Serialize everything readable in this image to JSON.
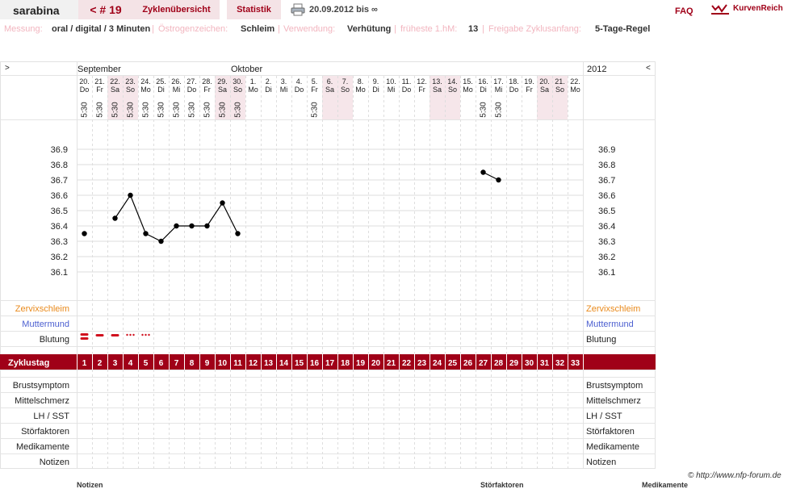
{
  "header": {
    "user": "sarabina",
    "cycle_label": "< # 19",
    "tabs": [
      "Zyklenübersicht",
      "Statistik"
    ],
    "date_range": "20.09.2012 bis ∞",
    "faq": "FAQ",
    "brand": "KurvenReich"
  },
  "settings": [
    {
      "label": "Messung:",
      "value": "oral / digital / 3 Minuten"
    },
    {
      "label": "Östrogenzeichen:",
      "value": "Schleim"
    },
    {
      "label": "Verwendung:",
      "value": "Verhütung"
    },
    {
      "label": "früheste 1.hM:",
      "value": "13"
    },
    {
      "label": "Freigabe Zyklusanfang:",
      "value": "5-Tage-Regel"
    }
  ],
  "colors": {
    "accent": "#a00018",
    "weekend": "#f6e6ea",
    "cervix_label": "#e98a1c",
    "mouth_label": "#4c5fd0",
    "grid": "#dcdcdc"
  },
  "chart_data": {
    "type": "line",
    "nav_left": ">",
    "nav_right": "<",
    "year": "2012",
    "months": [
      {
        "name": "September",
        "start_day": 1
      },
      {
        "name": "Oktober",
        "start_day": 11
      }
    ],
    "days": [
      {
        "date": "20.",
        "wd": "Do",
        "time": "5:30",
        "weekend": false
      },
      {
        "date": "21.",
        "wd": "Fr",
        "time": "5:30",
        "weekend": false
      },
      {
        "date": "22.",
        "wd": "Sa",
        "time": "5:30",
        "weekend": true
      },
      {
        "date": "23.",
        "wd": "So",
        "time": "5:30",
        "weekend": true
      },
      {
        "date": "24.",
        "wd": "Mo",
        "time": "5:30",
        "weekend": false
      },
      {
        "date": "25.",
        "wd": "Di",
        "time": "5:30",
        "weekend": false
      },
      {
        "date": "26.",
        "wd": "Mi",
        "time": "5:30",
        "weekend": false
      },
      {
        "date": "27.",
        "wd": "Do",
        "time": "5:30",
        "weekend": false
      },
      {
        "date": "28.",
        "wd": "Fr",
        "time": "5:30",
        "weekend": false
      },
      {
        "date": "29.",
        "wd": "Sa",
        "time": "5:30",
        "weekend": true
      },
      {
        "date": "30.",
        "wd": "So",
        "time": "5:30",
        "weekend": true
      },
      {
        "date": "1.",
        "wd": "Mo",
        "time": "",
        "weekend": false
      },
      {
        "date": "2.",
        "wd": "Di",
        "time": "",
        "weekend": false
      },
      {
        "date": "3.",
        "wd": "Mi",
        "time": "",
        "weekend": false
      },
      {
        "date": "4.",
        "wd": "Do",
        "time": "",
        "weekend": false
      },
      {
        "date": "5.",
        "wd": "Fr",
        "time": "5:30",
        "weekend": false
      },
      {
        "date": "6.",
        "wd": "Sa",
        "time": "",
        "weekend": true
      },
      {
        "date": "7.",
        "wd": "So",
        "time": "",
        "weekend": true
      },
      {
        "date": "8.",
        "wd": "Mo",
        "time": "",
        "weekend": false
      },
      {
        "date": "9.",
        "wd": "Di",
        "time": "",
        "weekend": false
      },
      {
        "date": "10.",
        "wd": "Mi",
        "time": "",
        "weekend": false
      },
      {
        "date": "11.",
        "wd": "Do",
        "time": "",
        "weekend": false
      },
      {
        "date": "12.",
        "wd": "Fr",
        "time": "",
        "weekend": false
      },
      {
        "date": "13.",
        "wd": "Sa",
        "time": "",
        "weekend": true
      },
      {
        "date": "14.",
        "wd": "So",
        "time": "",
        "weekend": true
      },
      {
        "date": "15.",
        "wd": "Mo",
        "time": "",
        "weekend": false
      },
      {
        "date": "16.",
        "wd": "Di",
        "time": "5:30",
        "weekend": false
      },
      {
        "date": "17.",
        "wd": "Mi",
        "time": "5:30",
        "weekend": false
      },
      {
        "date": "18.",
        "wd": "Do",
        "time": "",
        "weekend": false
      },
      {
        "date": "19.",
        "wd": "Fr",
        "time": "",
        "weekend": false
      },
      {
        "date": "20.",
        "wd": "Sa",
        "time": "",
        "weekend": true
      },
      {
        "date": "21.",
        "wd": "So",
        "time": "",
        "weekend": true
      },
      {
        "date": "22.",
        "wd": "Mo",
        "time": "",
        "weekend": false
      }
    ],
    "y_ticks": [
      "36.9",
      "36.8",
      "36.7",
      "36.6",
      "36.5",
      "36.4",
      "36.3",
      "36.2",
      "36.1"
    ],
    "ylim": [
      36.1,
      36.9
    ],
    "temperature_segments": [
      [
        {
          "day": 1,
          "y": 36.35
        }
      ],
      [
        {
          "day": 3,
          "y": 36.45
        },
        {
          "day": 4,
          "y": 36.6
        },
        {
          "day": 5,
          "y": 36.35
        },
        {
          "day": 6,
          "y": 36.3
        },
        {
          "day": 7,
          "y": 36.4
        },
        {
          "day": 8,
          "y": 36.4
        },
        {
          "day": 9,
          "y": 36.4
        },
        {
          "day": 10,
          "y": 36.55
        },
        {
          "day": 11,
          "y": 36.35
        }
      ],
      [
        {
          "day": 27,
          "y": 36.75
        },
        {
          "day": 28,
          "y": 36.7
        }
      ]
    ],
    "bleeding": [
      {
        "day": 1,
        "kind": "heavy"
      },
      {
        "day": 2,
        "kind": "medium"
      },
      {
        "day": 3,
        "kind": "medium"
      },
      {
        "day": 4,
        "kind": "light"
      },
      {
        "day": 5,
        "kind": "light"
      }
    ],
    "row_labels": {
      "cervix": "Zervixschleim",
      "mouth": "Muttermund",
      "bleeding": "Blutung",
      "cycle_day": "Zyklustag",
      "breast": "Brustsymptom",
      "mittel": "Mittelschmerz",
      "lh": "LH / SST",
      "stoer": "Störfaktoren",
      "medi": "Medikamente",
      "notes": "Notizen"
    }
  },
  "footer": {
    "copyright": "© http://www.nfp-forum.de",
    "peek": [
      "Notizen",
      "Störfaktoren",
      "Medikamente"
    ]
  }
}
